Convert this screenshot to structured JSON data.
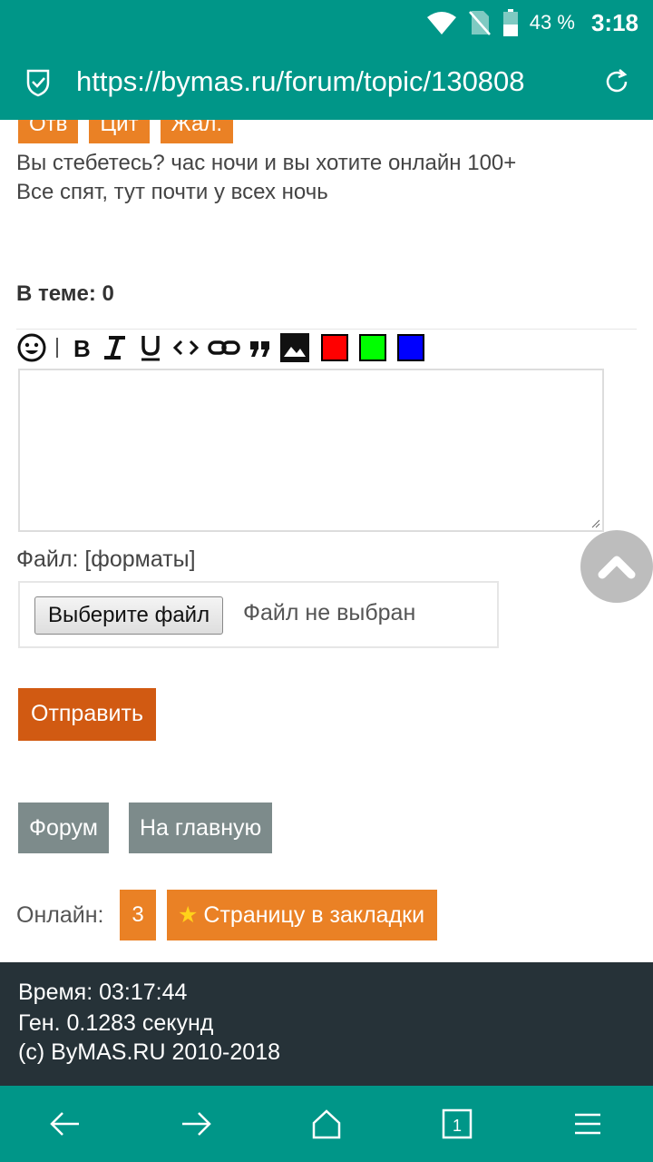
{
  "status_bar": {
    "battery_percent": "43 %",
    "time": "3:18",
    "icons": [
      "wifi-icon",
      "no-sim-icon",
      "battery-icon"
    ]
  },
  "address_bar": {
    "url": "https://bymas.ru/forum/topic/130808",
    "icons": [
      "shield-icon",
      "reload-icon"
    ]
  },
  "post": {
    "actions": [
      "Отв",
      "Цит",
      "Жал."
    ],
    "text_line1": "Вы стебетесь? час ночи и вы хотите онлайн 100+",
    "text_line2": "Все спят, тут почти у всех ночь"
  },
  "in_theme": "В теме: 0",
  "editor": {
    "toolbar": [
      "smile-icon",
      "bold-icon",
      "italic-icon",
      "underline-icon",
      "code-icon",
      "link-icon",
      "quote-icon",
      "image-icon"
    ],
    "colors": [
      "#ff0000",
      "#00ff00",
      "#0000ff"
    ]
  },
  "file": {
    "label": "Файл: [форматы]",
    "choose_button": "Выберите файл",
    "status": "Файл не выбран"
  },
  "submit_label": "Отправить",
  "nav_buttons": {
    "forum": "Форум",
    "home": "На главную"
  },
  "online": {
    "label": "Онлайн:",
    "count": "3",
    "bookmark_label": "Страницу в закладки",
    "bookmark_icon": "star-icon"
  },
  "footer": {
    "time_line": "Время: 03:17:44",
    "gen_line": "Ген. 0.1283 секунд",
    "copyright": "(c) ByMAS.RU 2010-2018"
  },
  "bottom_nav": {
    "tab_count": "1",
    "icons": [
      "back-arrow-icon",
      "forward-arrow-icon",
      "home-icon",
      "tabs-icon",
      "menu-icon"
    ]
  },
  "colors": {
    "teal": "#009688",
    "orange": "#ea8125",
    "submit": "#d15a12",
    "gray_button": "#7d8b8b",
    "footer_bg": "#263238"
  }
}
